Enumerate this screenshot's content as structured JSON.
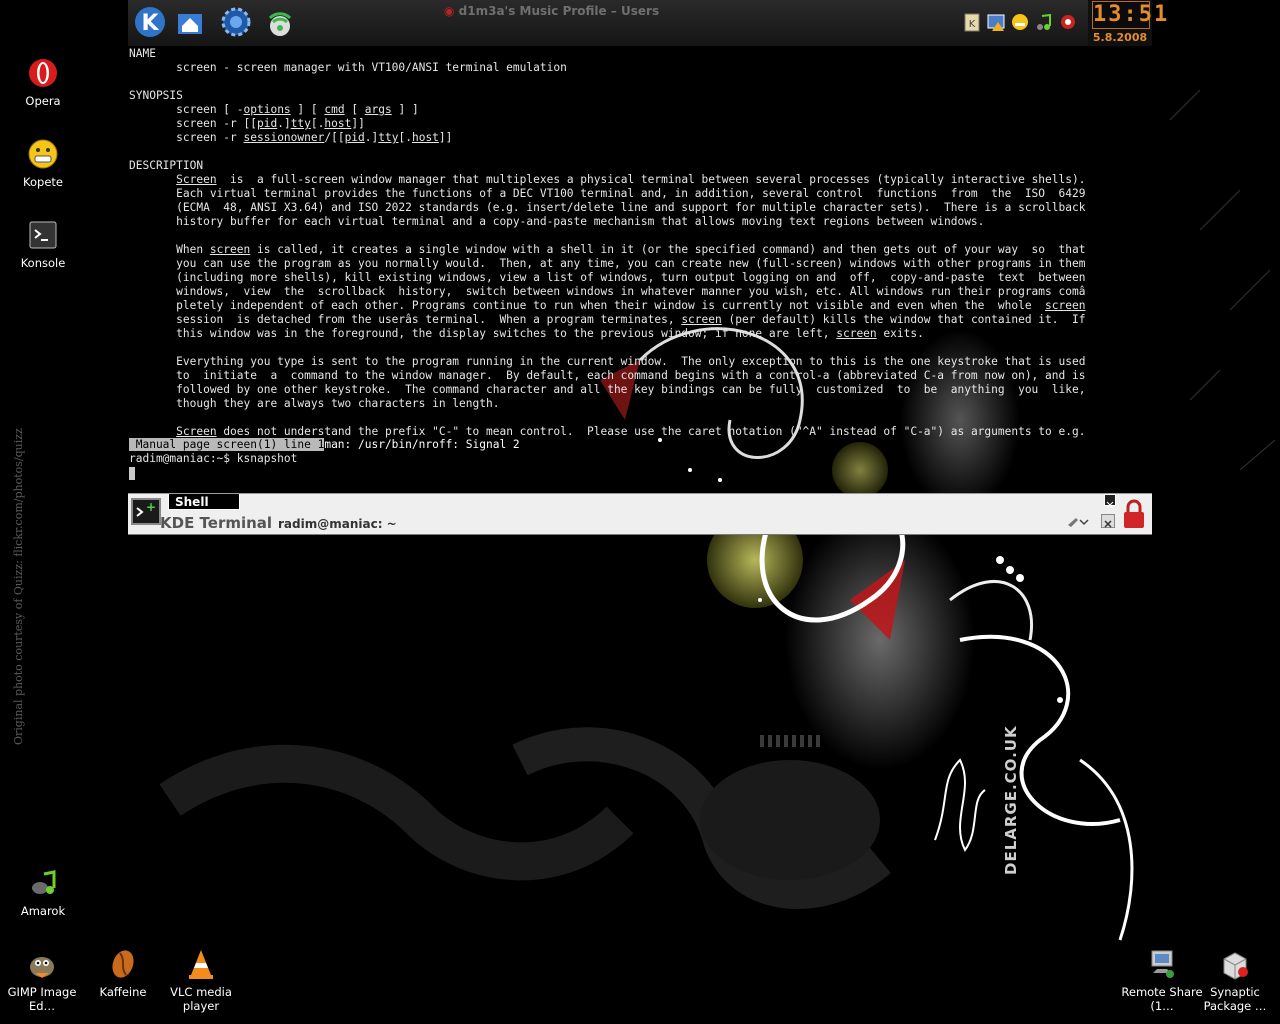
{
  "panel": {
    "taskbar_entry": "d1m3a's Music Profile – Users",
    "clock_time": "13:51",
    "clock_date": "5.8.2008"
  },
  "desktop": {
    "icons": [
      {
        "label": "Opera"
      },
      {
        "label": "Kopete"
      },
      {
        "label": "Konsole"
      },
      {
        "label": "Amarok"
      },
      {
        "label": "GIMP Image Ed…"
      },
      {
        "label": "Kaffeine"
      },
      {
        "label": "VLC media player"
      },
      {
        "label": "Remote Share (1…"
      },
      {
        "label": "Synaptic Package …"
      }
    ]
  },
  "wallpaper": {
    "credit": "Original photo courtesy of Quizz: flickr.com/photos/quizz",
    "brand": "DELARGE.CO.UK"
  },
  "terminal": {
    "lines": [
      "NAME",
      "       screen - screen manager with VT100/ANSI terminal emulation",
      "",
      "SYNOPSIS",
      "       screen [ -options ] [ cmd [ args ] ]",
      "       screen -r [[pid.]tty[.host]]",
      "       screen -r sessionowner/[[pid.]tty[.host]]",
      "",
      "DESCRIPTION",
      "       Screen  is  a full-screen window manager that multiplexes a physical terminal between several processes (typically interactive shells).",
      "       Each virtual terminal provides the functions of a DEC VT100 terminal and, in addition, several control  functions  from  the  ISO  6429",
      "       (ECMA  48, ANSI X3.64) and ISO 2022 standards (e.g. insert/delete line and support for multiple character sets).  There is a scrollback",
      "       history buffer for each virtual terminal and a copy-and-paste mechanism that allows moving text regions between windows.",
      "",
      "       When screen is called, it creates a single window with a shell in it (or the specified command) and then gets out of your way  so  that",
      "       you can use the program as you normally would.  Then, at any time, you can create new (full-screen) windows with other programs in them",
      "       (including more shells), kill existing windows, view a list of windows, turn output logging on and  off,  copy-and-paste  text  between",
      "       windows,  view  the  scrollback  history,  switch between windows in whatever manner you wish, etc. All windows run their programs comâ",
      "       pletely independent of each other. Programs continue to run when their window is currently not visible and even when the  whole  screen",
      "       session  is detached from the userâs terminal.  When a program terminates, screen (per default) kills the window that contained it.  If",
      "       this window was in the foreground, the display switches to the previous window; if none are left, screen exits.",
      "",
      "       Everything you type is sent to the program running in the current window.  The only exception to this is the one keystroke that is used",
      "       to  initiate  a  command to the window manager.  By default, each command begins with a control-a (abbreviated C-a from now on), and is",
      "       followed by one other keystroke.  The command character and all the key bindings can be fully  customized  to  be  anything  you  like,",
      "       though they are always two characters in length.",
      "",
      "       Screen does not understand the prefix \"C-\" to mean control.  Please use the caret notation (\"^A\" instead of \"C-a\") as arguments to e.g."
    ],
    "status_highlight": " Manual page screen(1) line 1",
    "status_rest": "man: /usr/bin/nroff: Signal 2",
    "prompt": "radim@maniac:~$ ksnapshot"
  },
  "konsole": {
    "tab_label": "Shell",
    "app_name": "KDE Terminal",
    "window_title": "radim@maniac: ~"
  }
}
